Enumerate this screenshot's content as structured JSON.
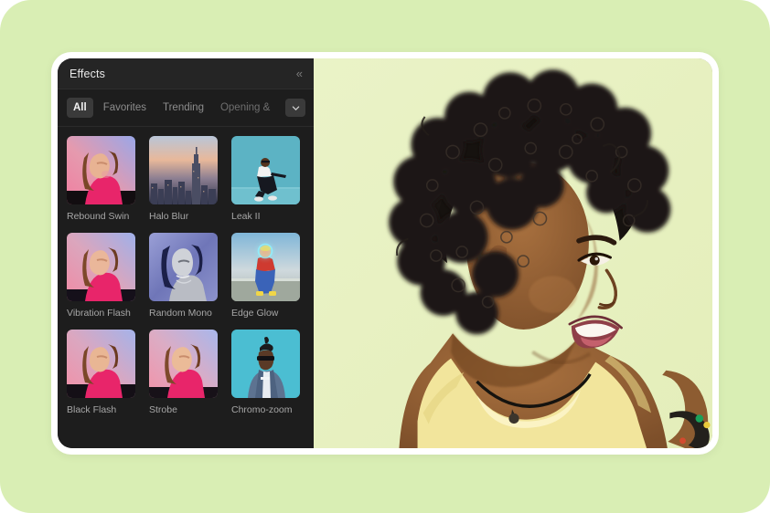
{
  "page": {
    "background_color": "#d9eeb4"
  },
  "window": {
    "frame_color": "#ffffff",
    "panel_background": "#1d1d1d"
  },
  "panel": {
    "title": "Effects",
    "collapse_icon": "chevron-double-left-icon",
    "collapse_glyph": "«"
  },
  "tabs": {
    "items": [
      {
        "label": "All",
        "active": true
      },
      {
        "label": "Favorites",
        "active": false
      },
      {
        "label": "Trending",
        "active": false
      },
      {
        "label": "Opening &",
        "active": false,
        "truncated": true
      }
    ],
    "more_button": {
      "icon": "chevron-down-icon",
      "label": "More categories"
    }
  },
  "effects": {
    "items": [
      {
        "name": "Rebound Swin",
        "thumb": "portrait-pink-blue"
      },
      {
        "name": "Halo Blur",
        "thumb": "city-skyline-dusk"
      },
      {
        "name": "Leak II",
        "thumb": "dancer-teal-wall"
      },
      {
        "name": "Vibration Flash",
        "thumb": "portrait-pink-blue"
      },
      {
        "name": "Random Mono",
        "thumb": "portrait-mono-blue"
      },
      {
        "name": "Edge Glow",
        "thumb": "skater-glow-outline"
      },
      {
        "name": "Black Flash",
        "thumb": "portrait-pink-blue"
      },
      {
        "name": "Strobe",
        "thumb": "portrait-pink-blue"
      },
      {
        "name": "Chromo-zoom",
        "thumb": "man-sunglasses-teal"
      }
    ]
  },
  "preview": {
    "name": "video-preview",
    "description": "Smiling woman with curly afro hair wearing a yellow tank top and black cord necklace on a pale green background",
    "background_color": "#eaf2c8"
  }
}
